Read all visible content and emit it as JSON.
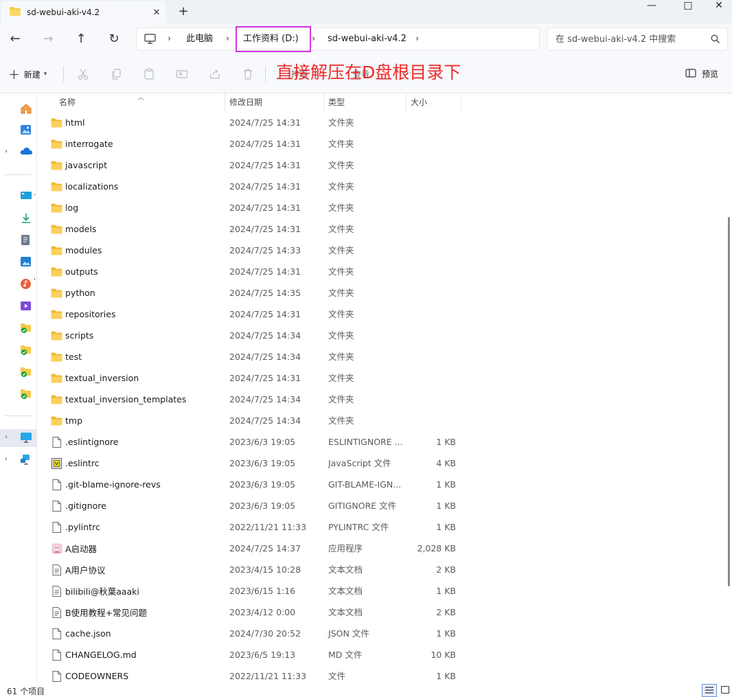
{
  "window": {
    "tab_title": "sd-webui-aki-v4.2",
    "tab_close": "✕",
    "new_tab": "+",
    "minimize": "—",
    "maximize": "□",
    "close": "✕"
  },
  "address": {
    "back": "←",
    "forward": "→",
    "up": "↑",
    "refresh": "↻",
    "breadcrumb": [
      "此电脑",
      "工作资料 (D:)",
      "sd-webui-aki-v4.2"
    ],
    "highlighted_segment": "工作资料 (D:)",
    "search_placeholder": "在 sd-webui-aki-v4.2 中搜索"
  },
  "toolbar": {
    "new_label": "新建",
    "sort_label": "排序",
    "view_label": "查看",
    "more_label": "···",
    "preview_label": "预览",
    "annotation": "直接解压在D盘根目录下",
    "icons": [
      "cut-icon",
      "copy-icon",
      "paste-icon",
      "rename-icon",
      "share-icon",
      "delete-icon"
    ]
  },
  "columns": {
    "name": "名称",
    "date": "修改日期",
    "type": "类型",
    "size": "大小"
  },
  "files": [
    {
      "name": "html",
      "date": "2024/7/25 14:31",
      "type": "文件夹",
      "size": "",
      "icon": "folder-icon"
    },
    {
      "name": "interrogate",
      "date": "2024/7/25 14:31",
      "type": "文件夹",
      "size": "",
      "icon": "folder-icon"
    },
    {
      "name": "javascript",
      "date": "2024/7/25 14:31",
      "type": "文件夹",
      "size": "",
      "icon": "folder-icon"
    },
    {
      "name": "localizations",
      "date": "2024/7/25 14:31",
      "type": "文件夹",
      "size": "",
      "icon": "folder-icon"
    },
    {
      "name": "log",
      "date": "2024/7/25 14:31",
      "type": "文件夹",
      "size": "",
      "icon": "folder-icon"
    },
    {
      "name": "models",
      "date": "2024/7/25 14:31",
      "type": "文件夹",
      "size": "",
      "icon": "folder-icon"
    },
    {
      "name": "modules",
      "date": "2024/7/25 14:33",
      "type": "文件夹",
      "size": "",
      "icon": "folder-icon"
    },
    {
      "name": "outputs",
      "date": "2024/7/25 14:31",
      "type": "文件夹",
      "size": "",
      "icon": "folder-icon"
    },
    {
      "name": "python",
      "date": "2024/7/25 14:35",
      "type": "文件夹",
      "size": "",
      "icon": "folder-icon"
    },
    {
      "name": "repositories",
      "date": "2024/7/25 14:31",
      "type": "文件夹",
      "size": "",
      "icon": "folder-icon"
    },
    {
      "name": "scripts",
      "date": "2024/7/25 14:34",
      "type": "文件夹",
      "size": "",
      "icon": "folder-icon"
    },
    {
      "name": "test",
      "date": "2024/7/25 14:34",
      "type": "文件夹",
      "size": "",
      "icon": "folder-icon"
    },
    {
      "name": "textual_inversion",
      "date": "2024/7/25 14:31",
      "type": "文件夹",
      "size": "",
      "icon": "folder-icon"
    },
    {
      "name": "textual_inversion_templates",
      "date": "2024/7/25 14:34",
      "type": "文件夹",
      "size": "",
      "icon": "folder-icon"
    },
    {
      "name": "tmp",
      "date": "2024/7/25 14:34",
      "type": "文件夹",
      "size": "",
      "icon": "folder-icon"
    },
    {
      "name": ".eslintignore",
      "date": "2023/6/3 19:05",
      "type": "ESLINTIGNORE ...",
      "size": "1 KB",
      "icon": "file-icon"
    },
    {
      "name": ".eslintrc",
      "date": "2023/6/3 19:05",
      "type": "JavaScript 文件",
      "size": "4 KB",
      "icon": "js-file-icon"
    },
    {
      "name": ".git-blame-ignore-revs",
      "date": "2023/6/3 19:05",
      "type": "GIT-BLAME-IGN...",
      "size": "1 KB",
      "icon": "file-icon"
    },
    {
      "name": ".gitignore",
      "date": "2023/6/3 19:05",
      "type": "GITIGNORE 文件",
      "size": "1 KB",
      "icon": "file-icon"
    },
    {
      "name": ".pylintrc",
      "date": "2022/11/21 11:33",
      "type": "PYLINTRC 文件",
      "size": "1 KB",
      "icon": "file-icon"
    },
    {
      "name": "A启动器",
      "date": "2024/7/25 14:37",
      "type": "应用程序",
      "size": "2,028 KB",
      "icon": "app-icon"
    },
    {
      "name": "A用户协议",
      "date": "2023/4/15 10:28",
      "type": "文本文档",
      "size": "2 KB",
      "icon": "text-file-icon"
    },
    {
      "name": "bilibili@秋葉aaaki",
      "date": "2023/6/15 1:16",
      "type": "文本文档",
      "size": "1 KB",
      "icon": "text-file-icon"
    },
    {
      "name": "B使用教程+常见问题",
      "date": "2023/4/12 0:00",
      "type": "文本文档",
      "size": "2 KB",
      "icon": "text-file-icon"
    },
    {
      "name": "cache.json",
      "date": "2024/7/30 20:52",
      "type": "JSON 文件",
      "size": "1 KB",
      "icon": "file-icon"
    },
    {
      "name": "CHANGELOG.md",
      "date": "2023/6/5 19:13",
      "type": "MD 文件",
      "size": "10 KB",
      "icon": "file-icon"
    },
    {
      "name": "CODEOWNERS",
      "date": "2022/11/21 11:33",
      "type": "文件",
      "size": "1 KB",
      "icon": "file-icon"
    }
  ],
  "nav": {
    "items": [
      {
        "icon": "home-icon",
        "label": "",
        "expandable": false
      },
      {
        "icon": "gallery-icon",
        "label": "",
        "expandable": false
      },
      {
        "icon": "onedrive-icon",
        "label": "",
        "expandable": true
      },
      {
        "icon": "desktop-icon",
        "label": "",
        "expandable": false
      },
      {
        "icon": "downloads-icon",
        "label": "",
        "expandable": false
      },
      {
        "icon": "documents-icon",
        "label": "",
        "expandable": false
      },
      {
        "icon": "pictures-icon",
        "label": "",
        "expandable": false
      },
      {
        "icon": "music-icon",
        "label": "",
        "expandable": false
      },
      {
        "icon": "videos-icon",
        "label": "",
        "expandable": false
      },
      {
        "icon": "pinned-folder-icon",
        "label": "",
        "expandable": false
      },
      {
        "icon": "pinned-folder-icon",
        "label": "",
        "expandable": false
      },
      {
        "icon": "pinned-folder-icon",
        "label": "",
        "expandable": false
      },
      {
        "icon": "pinned-folder-icon",
        "label": "",
        "expandable": false
      },
      {
        "icon": "this-pc-icon",
        "label": "",
        "expandable": true
      },
      {
        "icon": "network-icon",
        "label": "",
        "expandable": true
      }
    ]
  },
  "status": {
    "item_count": "61 个项目"
  },
  "colors": {
    "folder": "#f7c948",
    "highlight_box": "#d535e0",
    "annotation": "#ee2a2a",
    "accent": "#0067c0"
  }
}
